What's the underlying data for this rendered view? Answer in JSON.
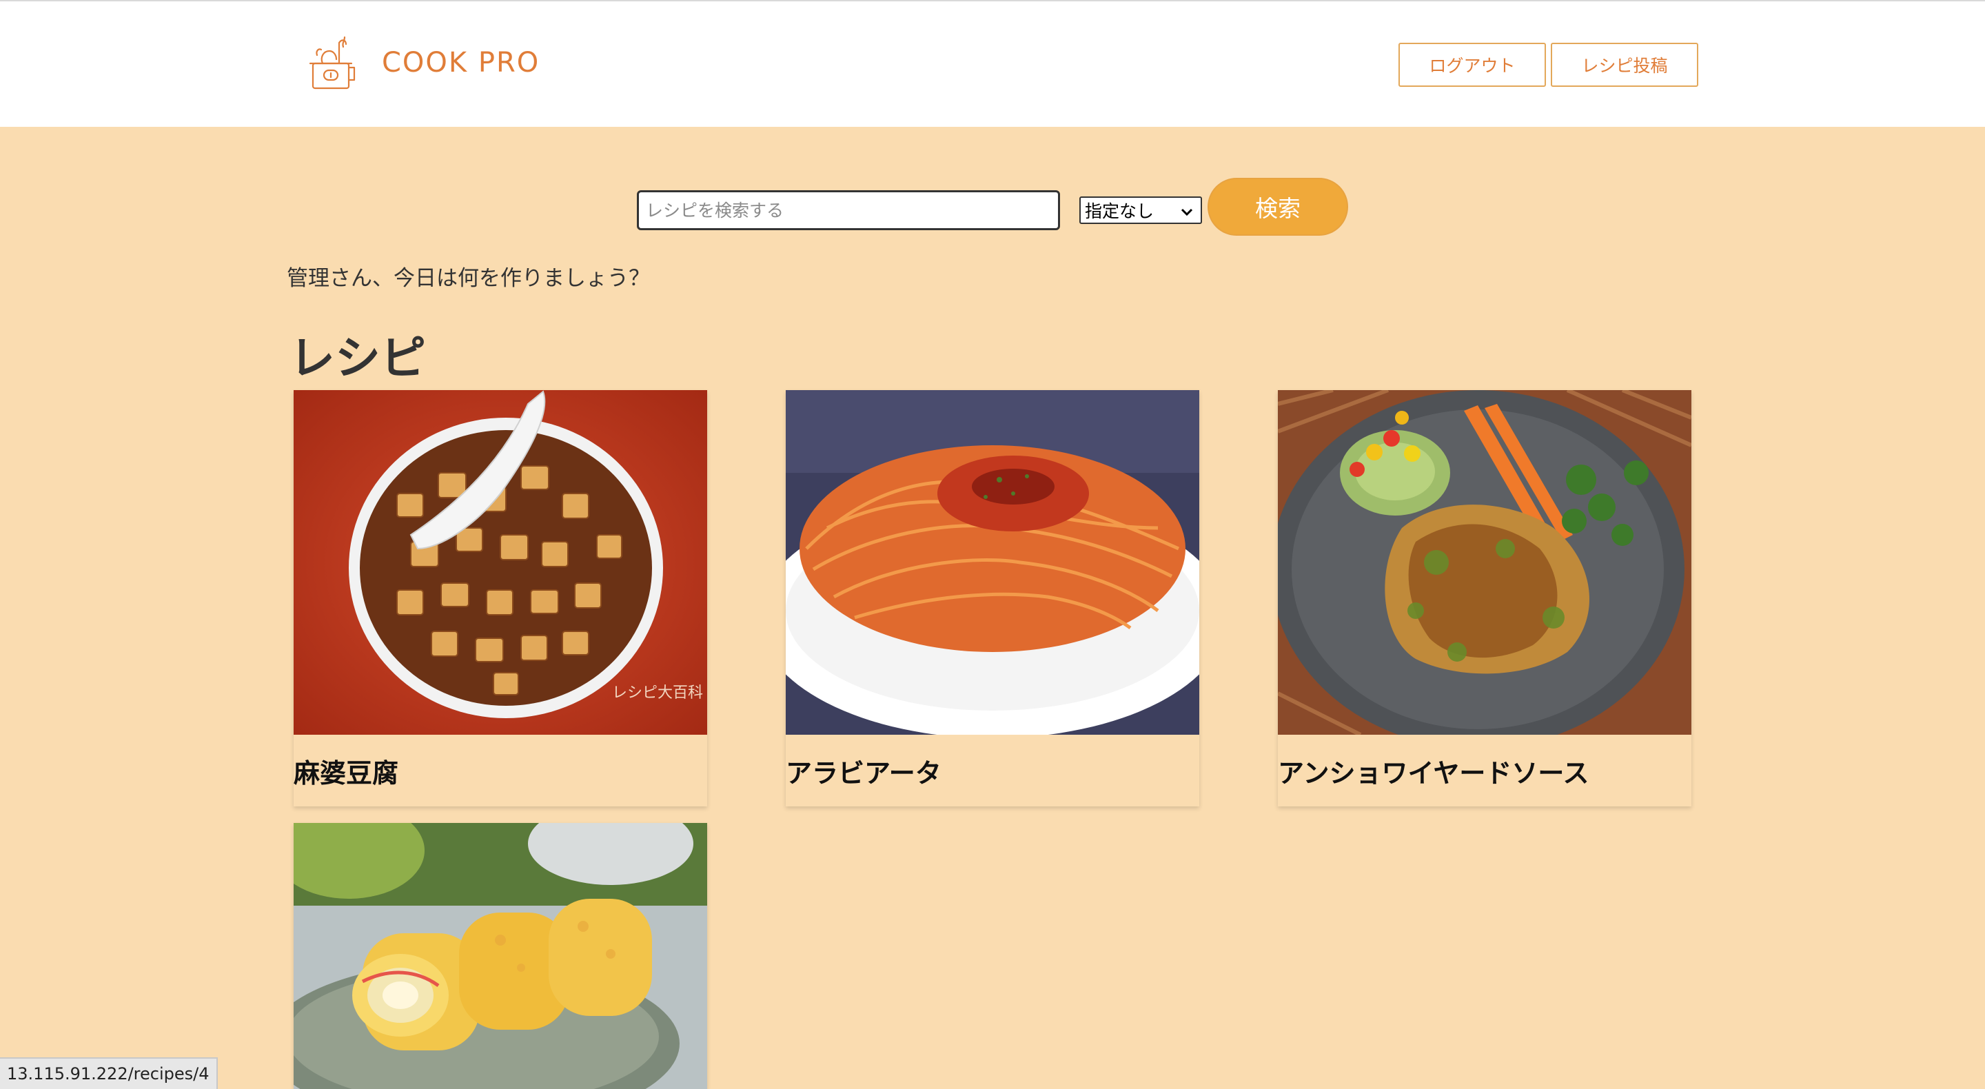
{
  "header": {
    "logo_text": "COOK PRO",
    "logout_label": "ログアウト",
    "post_label": "レシピ投稿"
  },
  "search": {
    "placeholder": "レシピを検索する",
    "value": "",
    "filter_selected": "指定なし",
    "button_label": "検索"
  },
  "greeting": "管理さん、今日は何を作りましょう？",
  "section_title": "レシピ",
  "recipes": [
    {
      "title": "麻婆豆腐",
      "image_icon": "mapo-tofu-image"
    },
    {
      "title": "アラビアータ",
      "image_icon": "arrabbiata-image"
    },
    {
      "title": "アンショワイヤードソース",
      "image_icon": "chicken-sauce-image"
    },
    {
      "title": "",
      "image_icon": "tamagoyaki-image"
    }
  ],
  "watermark_text": "レシピ大百科",
  "status_url": "13.115.91.222/recipes/4",
  "colors": {
    "background": "#fadcb0",
    "brand": "#e07d38",
    "button": "#f0a93a"
  }
}
